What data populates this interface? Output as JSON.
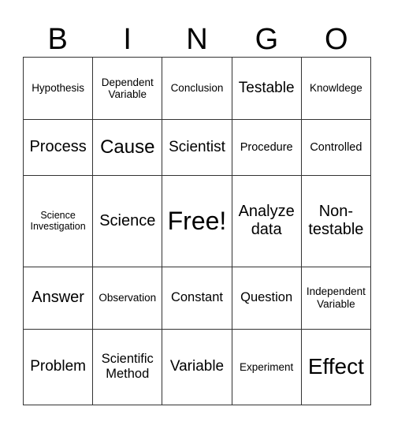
{
  "header": [
    "B",
    "I",
    "N",
    "G",
    "O"
  ],
  "grid": [
    [
      "Hypothesis",
      "Dependent Variable",
      "Conclusion",
      "Testable",
      "Knowldege"
    ],
    [
      "Process",
      "Cause",
      "Scientist",
      "Procedure",
      "Controlled"
    ],
    [
      "Science Investigation",
      "Science",
      "Free!",
      "Analyze data",
      "Non-testable"
    ],
    [
      "Answer",
      "Observation",
      "Constant",
      "Question",
      "Independent Variable"
    ],
    [
      "Problem",
      "Scientific Method",
      "Variable",
      "Experiment",
      "Effect"
    ]
  ]
}
